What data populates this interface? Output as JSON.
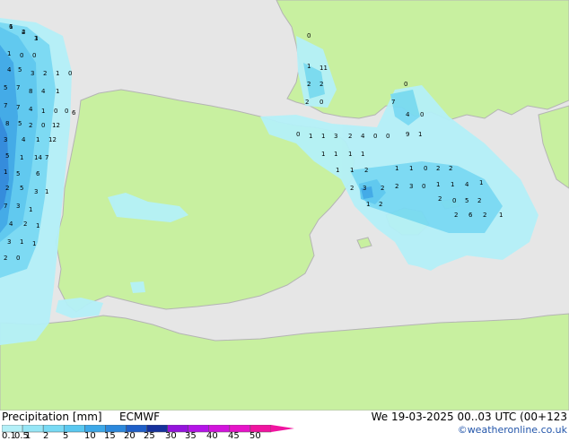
{
  "footer": {
    "title": "Precipitation [mm]",
    "model": "ECMWF",
    "datetime": "We 19-03-2025 00..03 UTC (00+123",
    "credit": "©weatheronline.co.uk"
  },
  "legend": {
    "labels": [
      "0.1",
      "0.5",
      "1",
      "2",
      "5",
      "10",
      "15",
      "20",
      "25",
      "30",
      "35",
      "40",
      "45",
      "50"
    ],
    "colors": [
      "#b4f0f8",
      "#96e6f6",
      "#78daf4",
      "#5ac8f0",
      "#3ca8e8",
      "#2c88dc",
      "#1f5fc8",
      "#16319c",
      "#9414dc",
      "#b414e8",
      "#d214dc",
      "#e614c8",
      "#f014a0"
    ]
  },
  "colors": {
    "land": "#c8f0a0",
    "sea": "#e6e6e6",
    "border": "#b4b4b4"
  },
  "map_labels": [
    "6",
    "4",
    "1",
    "1",
    "0",
    "0",
    "4",
    "5",
    "3",
    "2",
    "1",
    "0",
    "5",
    "7",
    "8",
    "4",
    "1",
    "7",
    "7",
    "4",
    "1",
    "0",
    "0",
    "6",
    "8",
    "5",
    "2",
    "0",
    "12",
    "3",
    "4",
    "1",
    "12",
    "5",
    "1",
    "14",
    "7",
    "1",
    "5",
    "6",
    "2",
    "5",
    "3",
    "1",
    "7",
    "3",
    "1",
    "4",
    "2",
    "1",
    "3",
    "1",
    "1",
    "2",
    "0",
    "0",
    "1",
    "11",
    "2",
    "2",
    "2",
    "0",
    "0",
    "1",
    "7",
    "0",
    "4",
    "0",
    "1",
    "3",
    "2",
    "4",
    "0",
    "0",
    "9",
    "1",
    "1",
    "1",
    "1",
    "1",
    "1",
    "1",
    "2",
    "1",
    "1",
    "0",
    "2",
    "2",
    "2",
    "3",
    "2",
    "2",
    "3",
    "0",
    "1",
    "1",
    "4",
    "1",
    "1",
    "2",
    "2",
    "0",
    "5",
    "2",
    "2",
    "6",
    "2",
    "1",
    "1",
    "2",
    "3"
  ]
}
